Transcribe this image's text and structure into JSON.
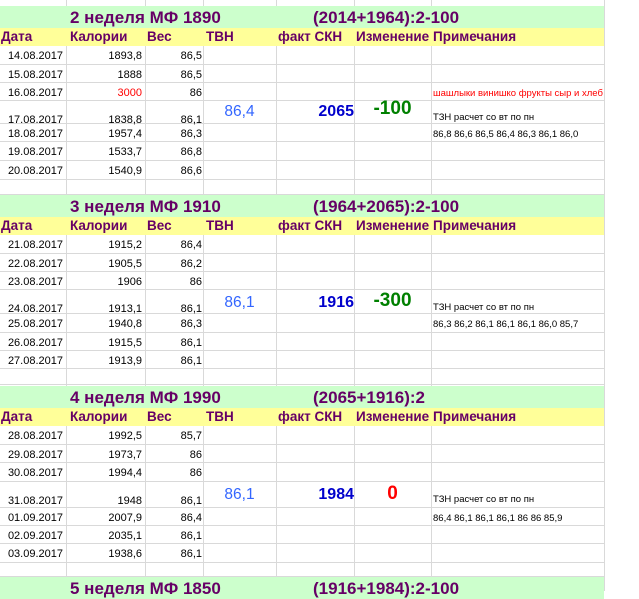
{
  "weeks": [
    {
      "title": "2 неделя МФ  1890",
      "formula": "(2014+1964):2-100",
      "headers": {
        "date": "Дата",
        "calories": "Калории",
        "weight": "Вес",
        "tvn": "ТВН",
        "fact": "факт СКН",
        "change": "Изменение",
        "notes": "Примечания"
      },
      "rows": [
        {
          "date": "14.08.2017",
          "calories": "1893,8",
          "weight": "86,5"
        },
        {
          "date": "15.08.2017",
          "calories": "1888",
          "weight": "86,5"
        },
        {
          "date": "16.08.2017",
          "calories": "3000",
          "weight": "86",
          "note": "шашлыки винишко фрукты сыр и хлеб"
        },
        {
          "date": "17.08.2017",
          "calories": "1838,8",
          "weight": "86,1",
          "tvn": "86,4",
          "fact": "2065",
          "change": "-100",
          "note": "ТЗН расчет со вт по пн"
        },
        {
          "date": "18.08.2017",
          "calories": "1957,4",
          "weight": "86,3",
          "note": "86,8  86,6  86,5  86,4  86,3  86,1  86,0"
        },
        {
          "date": "19.08.2017",
          "calories": "1533,7",
          "weight": "86,8"
        },
        {
          "date": "20.08.2017",
          "calories": "1540,9",
          "weight": "86,6"
        }
      ]
    },
    {
      "title": "3 неделя МФ  1910",
      "formula": "(1964+2065):2-100",
      "headers": {
        "date": "Дата",
        "calories": "Калории",
        "weight": "Вес",
        "tvn": "ТВН",
        "fact": "факт СКН",
        "change": "Изменение",
        "notes": "Примечания"
      },
      "rows": [
        {
          "date": "21.08.2017",
          "calories": "1915,2",
          "weight": "86,4"
        },
        {
          "date": "22.08.2017",
          "calories": "1905,5",
          "weight": "86,2"
        },
        {
          "date": "23.08.2017",
          "calories": "1906",
          "weight": "86"
        },
        {
          "date": "24.08.2017",
          "calories": "1913,1",
          "weight": "86,1",
          "tvn": "86,1",
          "fact": "1916",
          "change": "-300",
          "note": "ТЗН расчет со вт по пн"
        },
        {
          "date": "25.08.2017",
          "calories": "1940,8",
          "weight": "86,3",
          "note": "86,3  86,2  86,1  86,1  86,1  86,0  85,7"
        },
        {
          "date": "26.08.2017",
          "calories": "1915,5",
          "weight": "86,1"
        },
        {
          "date": "27.08.2017",
          "calories": "1913,9",
          "weight": "86,1"
        }
      ]
    },
    {
      "title": "4 неделя МФ  1990",
      "formula": "(2065+1916):2",
      "headers": {
        "date": "Дата",
        "calories": "Калории",
        "weight": "Вес",
        "tvn": "ТВН",
        "fact": "факт СКН",
        "change": "Изменение",
        "notes": "Примечания"
      },
      "rows": [
        {
          "date": "28.08.2017",
          "calories": "1992,5",
          "weight": "85,7"
        },
        {
          "date": "29.08.2017",
          "calories": "1973,7",
          "weight": "86"
        },
        {
          "date": "30.08.2017",
          "calories": "1994,4",
          "weight": "86"
        },
        {
          "date": "31.08.2017",
          "calories": "1948",
          "weight": "86,1",
          "tvn": "86,1",
          "fact": "1984",
          "change": "0",
          "note": "ТЗН расчет со вт по пн"
        },
        {
          "date": "01.09.2017",
          "calories": "2007,9",
          "weight": "86,4",
          "note": "86,4  86,1  86,1  86,1  86  86  85,9"
        },
        {
          "date": "02.09.2017",
          "calories": "2035,1",
          "weight": "86,1"
        },
        {
          "date": "03.09.2017",
          "calories": "1938,6",
          "weight": "86,1"
        }
      ]
    },
    {
      "title": "5 неделя МФ  1850",
      "formula": "(1916+1984):2-100"
    }
  ],
  "colors": {
    "title_bg": "#ccffcc",
    "header_bg": "#ffff99",
    "title_text": "#660066",
    "tvn_blue": "#3366ff",
    "fact_blue": "#0000cc",
    "change_green": "#008000",
    "change_red": "#ff0000"
  }
}
